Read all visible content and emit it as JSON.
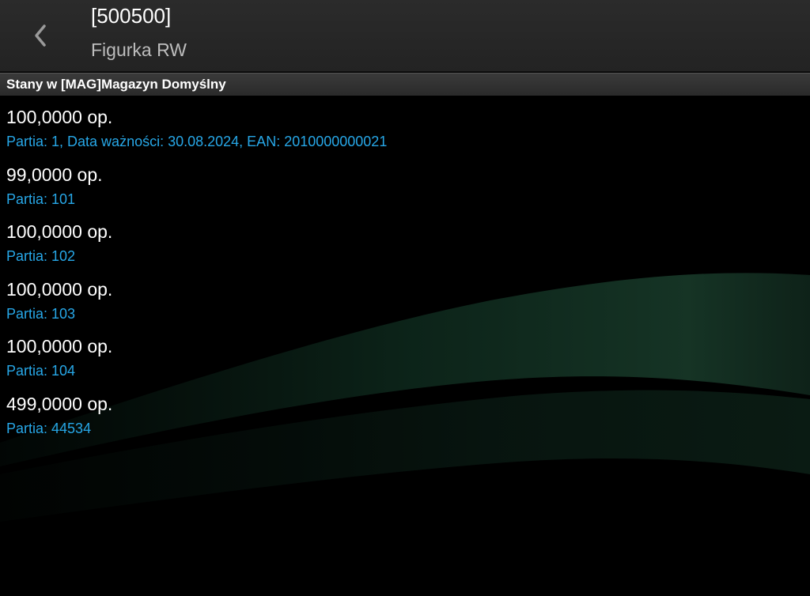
{
  "header": {
    "code": "[500500]",
    "name": "Figurka RW",
    "back_icon": "chevron-left-icon"
  },
  "section": {
    "title": "Stany w [MAG]Magazyn Domyślny"
  },
  "items": [
    {
      "quantity": "100,0000 op.",
      "details": "Partia: 1, Data ważności: 30.08.2024, EAN: 2010000000021"
    },
    {
      "quantity": "99,0000 op.",
      "details": "Partia: 101"
    },
    {
      "quantity": "100,0000 op.",
      "details": "Partia: 102"
    },
    {
      "quantity": "100,0000 op.",
      "details": "Partia: 103"
    },
    {
      "quantity": "100,0000 op.",
      "details": "Partia: 104"
    },
    {
      "quantity": "499,0000 op.",
      "details": "Partia: 44534"
    }
  ],
  "colors": {
    "background": "#000000",
    "header_bg": "#2b2b2b",
    "info_text": "#27a7e7",
    "wave": "#1f4a35"
  }
}
